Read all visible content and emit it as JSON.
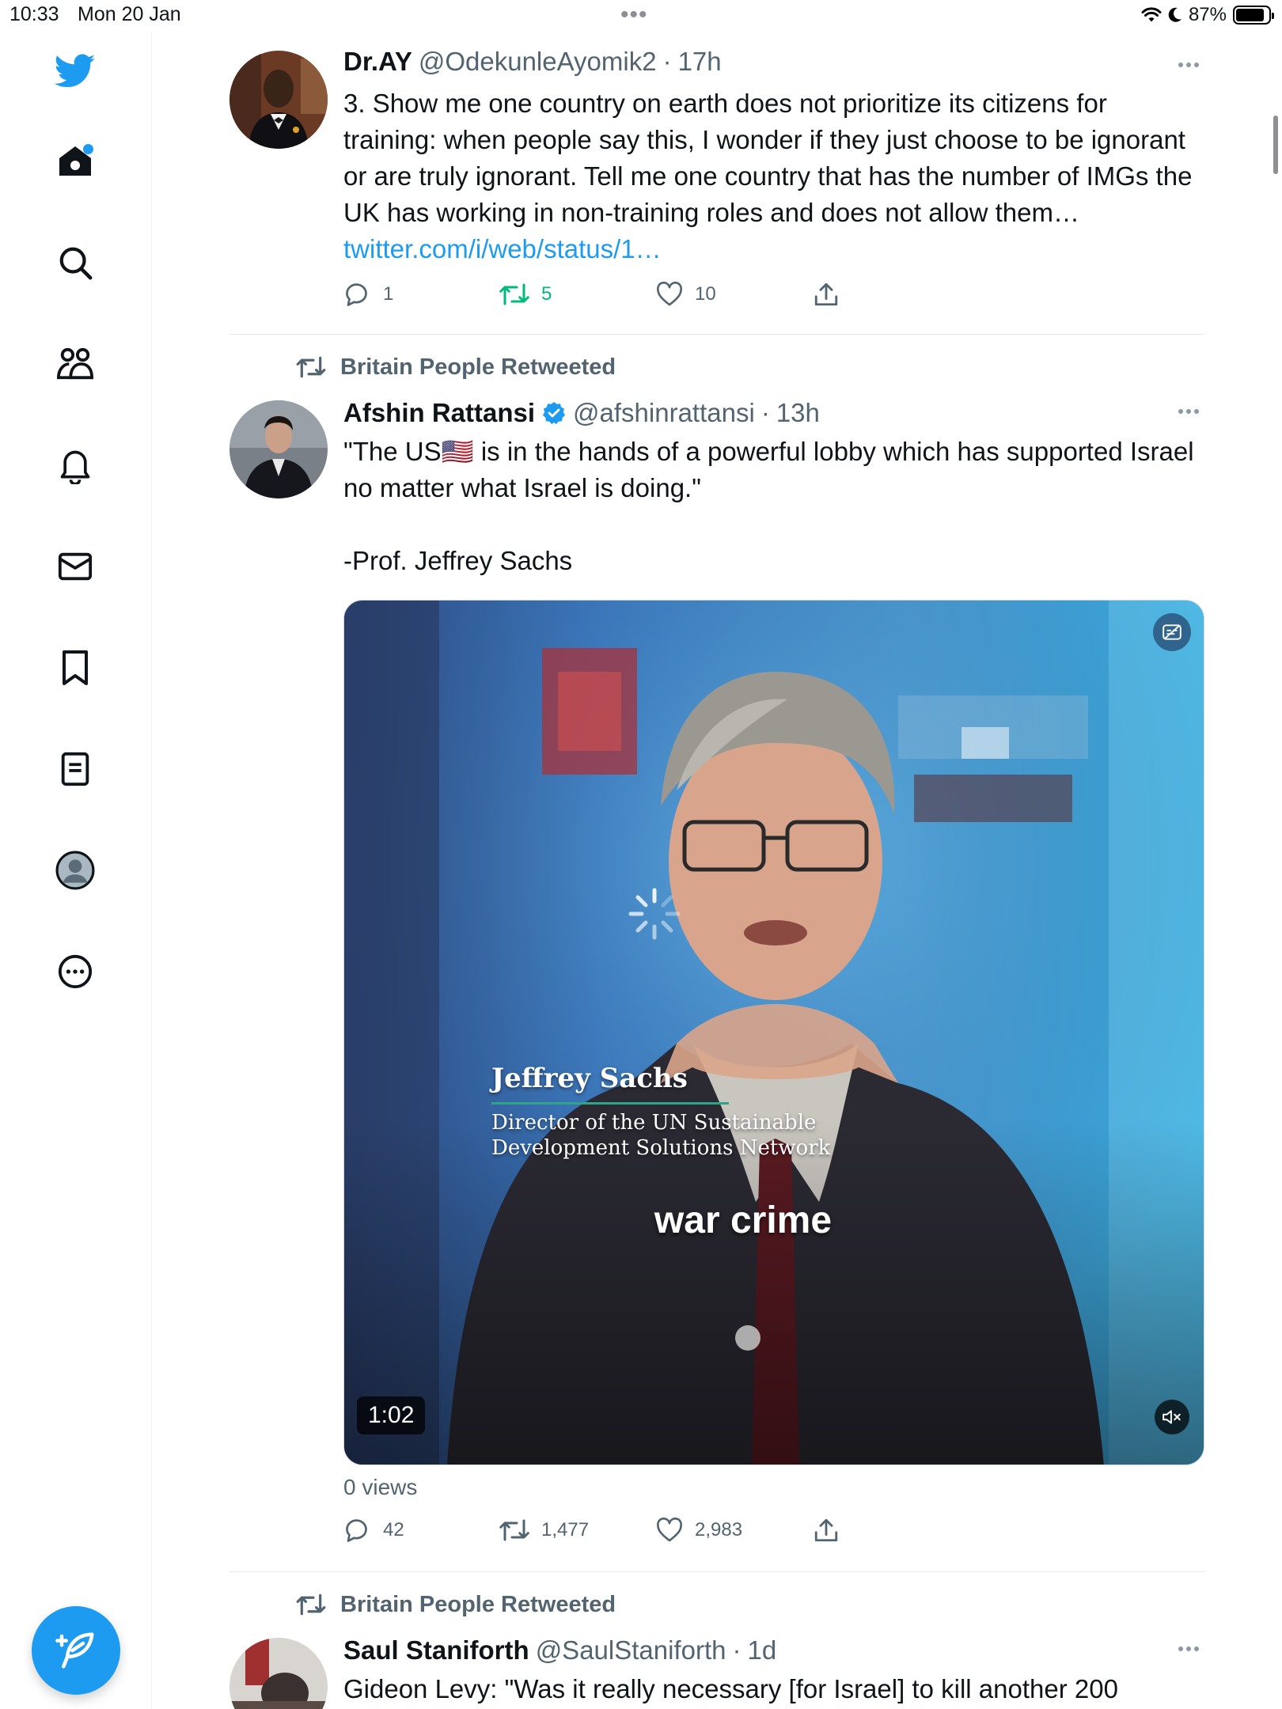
{
  "status_bar": {
    "time": "10:33",
    "date": "Mon 20 Jan",
    "battery": "87%",
    "battery_level": 0.87
  },
  "sidebar": {
    "items": [
      "home",
      "explore",
      "communities",
      "notifications",
      "messages",
      "bookmarks",
      "lists",
      "profile",
      "more"
    ],
    "compose_label": "Tweet"
  },
  "tweets": [
    {
      "name": "Dr.AY",
      "handle": "@OdekunleAyomik2",
      "dot": "·",
      "time": "17h",
      "text": "3. Show me one country on earth does not prioritize its citizens for training: when people say this, I wonder if they just choose to be ignorant or are truly ignorant. Tell me one country that has the number of IMGs the UK has working in non-training roles and does not allow them…",
      "link": "twitter.com/i/web/status/1…",
      "replies": "1",
      "retweets": "5",
      "likes": "10"
    },
    {
      "retweeted_by": "Britain People Retweeted",
      "name": "Afshin Rattansi",
      "handle": "@afshinrattansi",
      "dot": "·",
      "time": "13h",
      "text_line1": "\"The US🇺🇸 is in the hands of a powerful lobby which has supported Israel no matter what Israel is doing.\"",
      "text_line2": "-Prof. Jeffrey Sachs",
      "video": {
        "caption_name": "Jeffrey Sachs",
        "caption_title": "Director of the UN Sustainable Development Solutions Network",
        "subtitle": "war crime",
        "duration": "1:02"
      },
      "views": "0 views",
      "replies": "42",
      "retweets": "1,477",
      "likes": "2,983"
    },
    {
      "retweeted_by": "Britain People Retweeted",
      "name": "Saul Staniforth",
      "handle": "@SaulStaniforth",
      "dot": "·",
      "time": "1d",
      "text": "Gideon Levy: \"Was it really necessary [for Israel] to kill another 200"
    }
  ],
  "colors": {
    "accent": "#1d9bf0",
    "secondary_text": "#536471",
    "retweet_green": "#00ba7c"
  }
}
